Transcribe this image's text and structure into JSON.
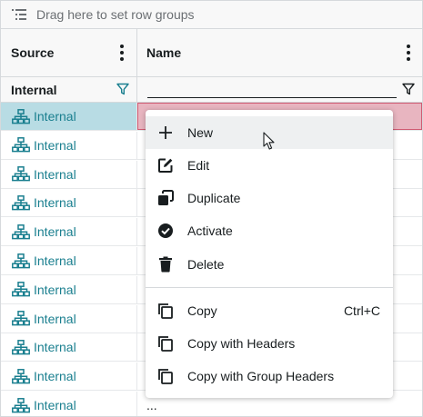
{
  "group_bar": {
    "icon": "row-groups-icon",
    "placeholder": "Drag here to set row groups"
  },
  "columns": [
    {
      "label": "Source",
      "menu_icon": "kebab-menu-icon"
    },
    {
      "label": "Name",
      "menu_icon": "kebab-menu-icon"
    }
  ],
  "filters": {
    "source_value": "Internal",
    "name_value": "",
    "filter_icon": "filter-icon"
  },
  "rows": [
    {
      "source": "Internal",
      "name": "",
      "selected": true
    },
    {
      "source": "Internal",
      "name": ""
    },
    {
      "source": "Internal",
      "name": ""
    },
    {
      "source": "Internal",
      "name": ""
    },
    {
      "source": "Internal",
      "name": ""
    },
    {
      "source": "Internal",
      "name": ""
    },
    {
      "source": "Internal",
      "name": ""
    },
    {
      "source": "Internal",
      "name": ""
    },
    {
      "source": "Internal",
      "name": ""
    },
    {
      "source": "Internal",
      "name": ""
    },
    {
      "source": "Internal",
      "name": "..."
    }
  ],
  "row_icon": "network-icon",
  "context_menu": {
    "items": [
      {
        "label": "New",
        "icon": "plus-icon",
        "hovered": true
      },
      {
        "label": "Edit",
        "icon": "edit-icon"
      },
      {
        "label": "Duplicate",
        "icon": "duplicate-icon"
      },
      {
        "label": "Activate",
        "icon": "check-circle-icon"
      },
      {
        "label": "Delete",
        "icon": "trash-icon"
      }
    ],
    "copy_items": [
      {
        "label": "Copy",
        "icon": "copy-icon",
        "shortcut": "Ctrl+C"
      },
      {
        "label": "Copy with Headers",
        "icon": "copy-icon",
        "shortcut": ""
      },
      {
        "label": "Copy with Group Headers",
        "icon": "copy-icon",
        "shortcut": ""
      }
    ]
  },
  "colors": {
    "accent": "#1a7f8f",
    "selected_source_bg": "#b8dce4",
    "selected_name_bg": "#e8b5c0",
    "menu_hover": "#eef0f1"
  }
}
